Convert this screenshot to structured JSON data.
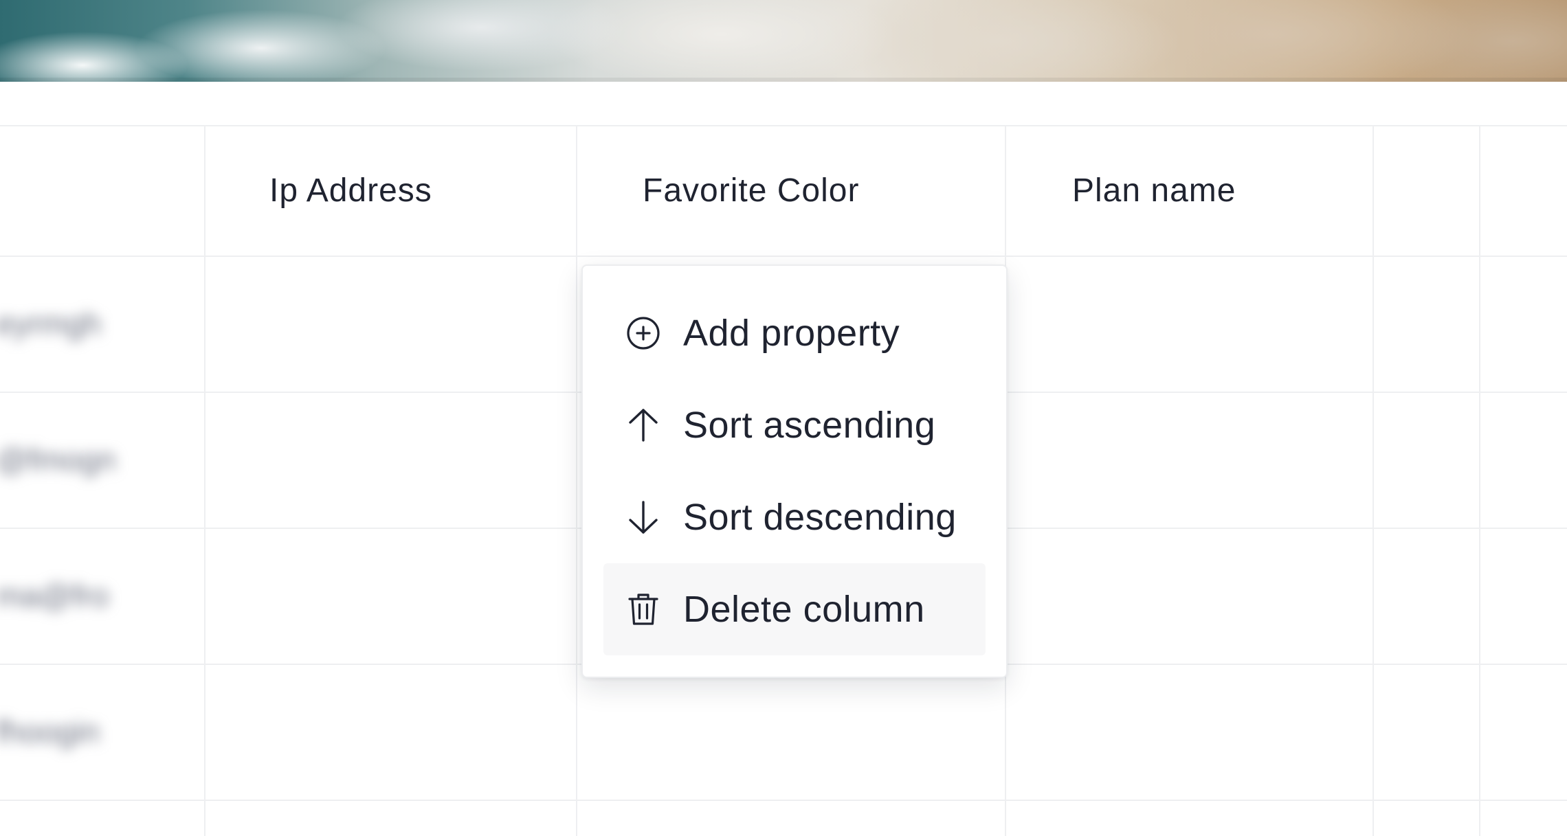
{
  "table": {
    "columns": [
      {
        "label": ""
      },
      {
        "label": "Ip Address"
      },
      {
        "label": "Favorite Color"
      },
      {
        "label": "Plan name"
      },
      {
        "label": ""
      }
    ],
    "blurred_cells": [
      "eyrmgh",
      "@fmogn",
      "ma@fro",
      "fhoogin"
    ]
  },
  "context_menu": {
    "items": [
      {
        "label": "Add property",
        "icon": "plus-circle-icon"
      },
      {
        "label": "Sort ascending",
        "icon": "arrow-up-icon"
      },
      {
        "label": "Sort descending",
        "icon": "arrow-down-icon"
      },
      {
        "label": "Delete column",
        "icon": "trash-icon",
        "hovered": true
      }
    ]
  },
  "colors": {
    "text": "#1f2330",
    "grid": "#eeeff1",
    "menu_hover": "#f7f7f8"
  }
}
